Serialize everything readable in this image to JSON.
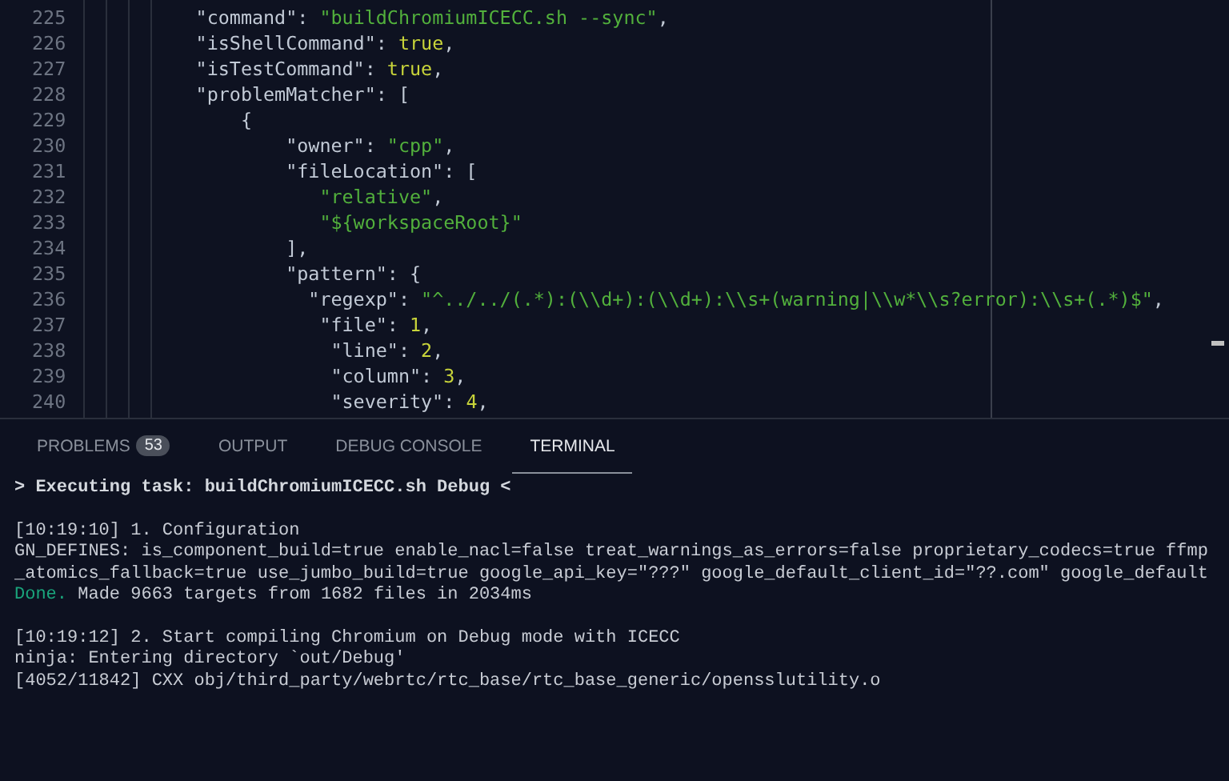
{
  "editor": {
    "lines": [
      {
        "number": "225",
        "tokens": [
          {
            "kind": "key",
            "text": "        \"command\""
          },
          {
            "kind": "punct",
            "text": ": "
          },
          {
            "kind": "string",
            "text": "\"buildChromiumICECC.sh --sync\""
          },
          {
            "kind": "punct",
            "text": ","
          }
        ]
      },
      {
        "number": "226",
        "tokens": [
          {
            "kind": "key",
            "text": "        \"isShellCommand\""
          },
          {
            "kind": "punct",
            "text": ": "
          },
          {
            "kind": "literal",
            "text": "true"
          },
          {
            "kind": "punct",
            "text": ","
          }
        ]
      },
      {
        "number": "227",
        "tokens": [
          {
            "kind": "key",
            "text": "        \"isTestCommand\""
          },
          {
            "kind": "punct",
            "text": ": "
          },
          {
            "kind": "literal",
            "text": "true"
          },
          {
            "kind": "punct",
            "text": ","
          }
        ]
      },
      {
        "number": "228",
        "tokens": [
          {
            "kind": "key",
            "text": "        \"problemMatcher\""
          },
          {
            "kind": "punct",
            "text": ": ["
          }
        ]
      },
      {
        "number": "229",
        "tokens": [
          {
            "kind": "punct",
            "text": "            {"
          }
        ]
      },
      {
        "number": "230",
        "tokens": [
          {
            "kind": "key",
            "text": "                \"owner\""
          },
          {
            "kind": "punct",
            "text": ": "
          },
          {
            "kind": "string",
            "text": "\"cpp\""
          },
          {
            "kind": "punct",
            "text": ","
          }
        ]
      },
      {
        "number": "231",
        "tokens": [
          {
            "kind": "key",
            "text": "                \"fileLocation\""
          },
          {
            "kind": "punct",
            "text": ": ["
          }
        ]
      },
      {
        "number": "232",
        "tokens": [
          {
            "kind": "string",
            "text": "                   \"relative\""
          },
          {
            "kind": "punct",
            "text": ","
          }
        ]
      },
      {
        "number": "233",
        "tokens": [
          {
            "kind": "string",
            "text": "                   \"${workspaceRoot}\""
          }
        ]
      },
      {
        "number": "234",
        "tokens": [
          {
            "kind": "punct",
            "text": "                ],"
          }
        ]
      },
      {
        "number": "235",
        "tokens": [
          {
            "kind": "key",
            "text": "                \"pattern\""
          },
          {
            "kind": "punct",
            "text": ": {"
          }
        ]
      },
      {
        "number": "236",
        "tokens": [
          {
            "kind": "key",
            "text": "                  \"regexp\""
          },
          {
            "kind": "punct",
            "text": ": "
          },
          {
            "kind": "string",
            "text": "\"^../../(.*):(\\\\d+):(\\\\d+):\\\\s+(warning|\\\\w*\\\\s?error):\\\\s+(.*)$\""
          },
          {
            "kind": "punct",
            "text": ","
          }
        ]
      },
      {
        "number": "237",
        "tokens": [
          {
            "kind": "key",
            "text": "                   \"file\""
          },
          {
            "kind": "punct",
            "text": ": "
          },
          {
            "kind": "literal",
            "text": "1"
          },
          {
            "kind": "punct",
            "text": ","
          }
        ]
      },
      {
        "number": "238",
        "tokens": [
          {
            "kind": "key",
            "text": "                    \"line\""
          },
          {
            "kind": "punct",
            "text": ": "
          },
          {
            "kind": "literal",
            "text": "2"
          },
          {
            "kind": "punct",
            "text": ","
          }
        ]
      },
      {
        "number": "239",
        "tokens": [
          {
            "kind": "key",
            "text": "                    \"column\""
          },
          {
            "kind": "punct",
            "text": ": "
          },
          {
            "kind": "literal",
            "text": "3"
          },
          {
            "kind": "punct",
            "text": ","
          }
        ]
      },
      {
        "number": "240",
        "tokens": [
          {
            "kind": "key",
            "text": "                    \"severity\""
          },
          {
            "kind": "punct",
            "text": ": "
          },
          {
            "kind": "literal",
            "text": "4"
          },
          {
            "kind": "punct",
            "text": ","
          }
        ]
      }
    ]
  },
  "panel": {
    "tabs": [
      {
        "label": "PROBLEMS",
        "badge": "53",
        "selected": false
      },
      {
        "label": "OUTPUT",
        "selected": false
      },
      {
        "label": "DEBUG CONSOLE",
        "selected": false
      },
      {
        "label": "TERMINAL",
        "selected": true
      }
    ],
    "terminal": {
      "blocks": [
        [
          [
            {
              "kind": "bold",
              "text": "> Executing task: buildChromiumICECC.sh Debug <"
            }
          ]
        ],
        [
          [
            {
              "kind": "plain",
              "text": "[10:19:10] 1. Configuration"
            }
          ],
          [
            {
              "kind": "plain",
              "text": "GN_DEFINES: is_component_build=true enable_nacl=false treat_warnings_as_errors=false proprietary_codecs=true ffmp"
            }
          ],
          [
            {
              "kind": "plain",
              "text": "_atomics_fallback=true use_jumbo_build=true google_api_key=\"???\" google_default_client_id=\"??.com\" google_default"
            }
          ],
          [
            {
              "kind": "success",
              "text": "Done."
            },
            {
              "kind": "plain",
              "text": " Made 9663 targets from 1682 files in 2034ms"
            }
          ]
        ],
        [
          [
            {
              "kind": "plain",
              "text": "[10:19:12] 2. Start compiling Chromium on Debug mode with ICECC"
            }
          ],
          [
            {
              "kind": "plain",
              "text": "ninja: Entering directory `out/Debug'"
            }
          ],
          [
            {
              "kind": "plain",
              "text": "[4052/11842] CXX obj/third_party/webrtc/rtc_base/rtc_base_generic/opensslutility.o"
            }
          ]
        ]
      ]
    }
  }
}
